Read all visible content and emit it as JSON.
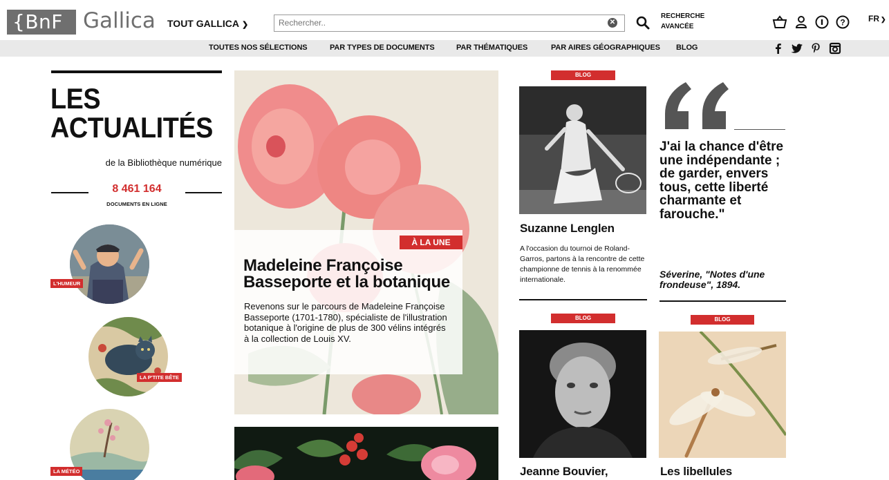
{
  "header": {
    "logo_bnf": "{BnF",
    "logo_gallica": "Gallica",
    "scope_selector": "TOUT GALLICA",
    "search": {
      "placeholder": "Rechercher..",
      "value": ""
    },
    "advanced_search_line1": "RECHERCHE",
    "advanced_search_line2": "AVANCÉE",
    "icons": [
      "basket-icon",
      "user-icon",
      "info-icon",
      "help-icon"
    ],
    "language": "FR"
  },
  "nav": {
    "items": [
      "TOUTES NOS SÉLECTIONS",
      "PAR TYPES DE DOCUMENTS",
      "PAR THÉMATIQUES",
      "PAR AIRES GÉOGRAPHIQUES",
      "BLOG"
    ],
    "social_icons": [
      "facebook-icon",
      "twitter-icon",
      "pinterest-icon",
      "instagram-icon"
    ]
  },
  "left": {
    "title_line1": "LES",
    "title_line2": "ACTUALITÉS",
    "subtitle": "de la Bibliothèque numérique",
    "counter_value": "8 461 164",
    "counter_label": "DOCUMENTS EN LIGNE",
    "rubrics": [
      {
        "label": "L'HUMEUR"
      },
      {
        "label": "LA P'TITE BÊTE"
      },
      {
        "label": "LA MÉTÉO"
      }
    ]
  },
  "feature": {
    "badge": "À LA UNE",
    "title": "Madeleine Françoise Basseporte et la botanique",
    "description": "Revenons sur le parcours de Madeleine Françoise Basseporte (1701-1780), spécialiste de l'illustration botanique à l'origine de plus de 300 vélins intégrés à la collection de Louis XV."
  },
  "cards": [
    {
      "tag": "BLOG",
      "title": "Suzanne Lenglen",
      "description": "A l'occasion du tournoi de Roland-Garros, partons à la rencontre de cette championne de tennis à la renommée internationale."
    },
    {
      "tag": "BLOG",
      "title": "Jeanne Bouvier,"
    },
    {
      "tag": "BLOG",
      "title": "Les libellules"
    }
  ],
  "quote": {
    "text": "J'ai la chance d'être une indépendante ; de garder, envers tous, cette liberté charmante et farouche.\"",
    "source": "Séverine, \"Notes d'une frondeuse\", 1894."
  },
  "colors": {
    "accent_red": "#d22e2e",
    "logo_grey": "#6f6f6f",
    "nav_bg": "#e9e9e9"
  }
}
